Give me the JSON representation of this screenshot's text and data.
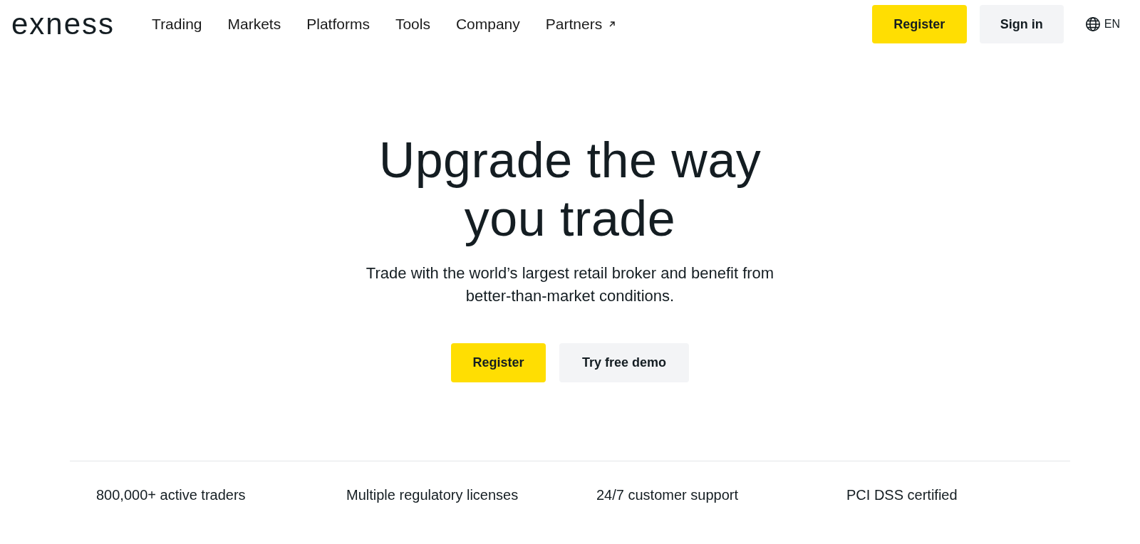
{
  "header": {
    "logo": "exness",
    "nav": [
      {
        "label": "Trading",
        "external": false
      },
      {
        "label": "Markets",
        "external": false
      },
      {
        "label": "Platforms",
        "external": false
      },
      {
        "label": "Tools",
        "external": false
      },
      {
        "label": "Company",
        "external": false
      },
      {
        "label": "Partners",
        "external": true
      }
    ],
    "register": "Register",
    "sign_in": "Sign in",
    "language": "EN"
  },
  "hero": {
    "title_lines": [
      "Upgrade the way",
      "you trade"
    ],
    "subtitle_lines": [
      "Trade with the world’s largest retail broker and benefit from",
      "better-than-market conditions."
    ],
    "primary": "Register",
    "secondary": "Try free demo"
  },
  "features": [
    "800,000+ active traders",
    "Multiple regulatory licenses",
    "24/7 customer support",
    "PCI DSS certified"
  ]
}
